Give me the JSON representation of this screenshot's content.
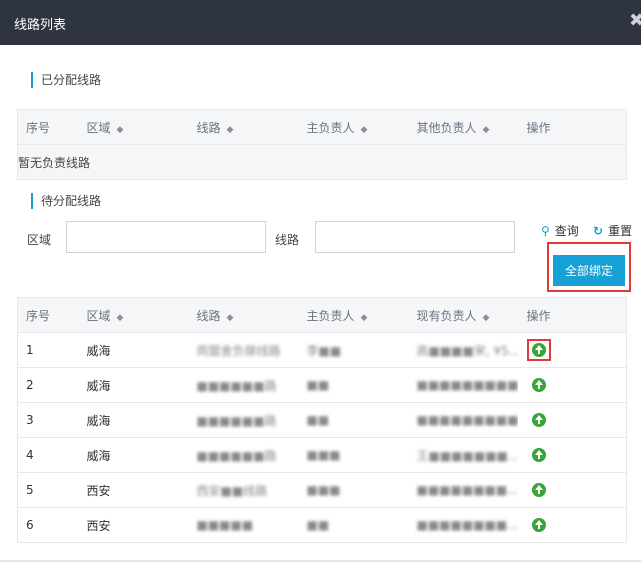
{
  "dialog": {
    "title": "线路列表",
    "close_glyph": "✖"
  },
  "assigned": {
    "section_title": "已分配线路",
    "headers": [
      "序号",
      "区域",
      "线路",
      "主负责人",
      "其他负责人",
      "操作"
    ],
    "empty_text": "暂无负责线路"
  },
  "pending": {
    "section_title": "待分配线路",
    "filter": {
      "region_label": "区域",
      "region_value": "",
      "route_label": "线路",
      "route_value": ""
    },
    "query_label": "查询",
    "reset_label": "重置",
    "bind_all_label": "全部绑定",
    "headers": [
      "序号",
      "区域",
      "线路",
      "主负责人",
      "现有负责人",
      "操作"
    ],
    "rows": [
      {
        "no": "1",
        "region": "威海",
        "route": "両盟舍负镓线路",
        "owner": "李■■",
        "current": "高■■■■宋, ¥5..."
      },
      {
        "no": "2",
        "region": "威海",
        "route": "■■■■■■路",
        "owner": "■■",
        "current": "■■■■■■■■■"
      },
      {
        "no": "3",
        "region": "威海",
        "route": "■■■■■■路",
        "owner": "■■",
        "current": "■■■■■■■■■..."
      },
      {
        "no": "4",
        "region": "威海",
        "route": "■■■■■■路",
        "owner": "■■■",
        "current": "王■■■■■■■..."
      },
      {
        "no": "5",
        "region": "西安",
        "route": "西安■■线路",
        "owner": "■■■",
        "current": "■■■■■■■■..."
      },
      {
        "no": "6",
        "region": "西安",
        "route": "■■■■■",
        "owner": "■■",
        "current": "■■■■■■■■..."
      }
    ]
  },
  "colors": {
    "titlebar": "#2f3540",
    "accent": "#1a9bd7",
    "op_icon": "#3aa33a",
    "highlight": "#e53935"
  }
}
